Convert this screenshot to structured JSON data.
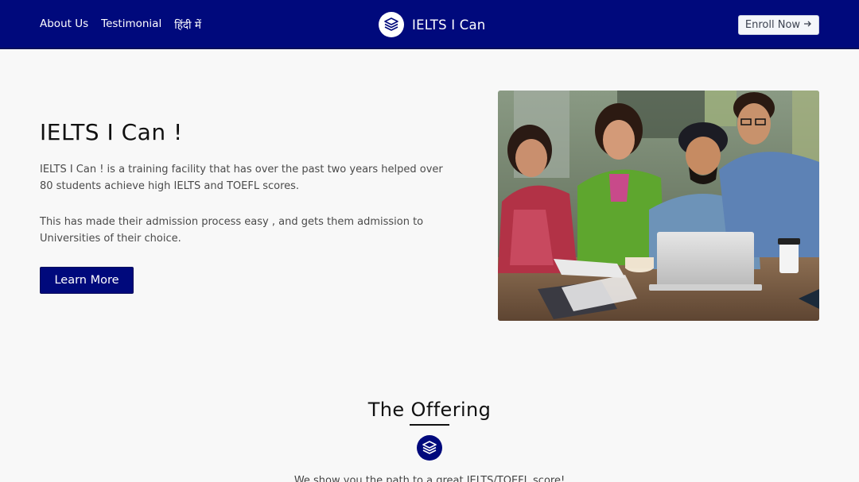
{
  "nav": {
    "links": [
      "About Us",
      "Testimonial",
      "हिंदी में"
    ],
    "brand": "IELTS I Can",
    "brand_icon": "layers-icon",
    "enroll_label": "Enroll Now",
    "enroll_icon": "arrow-right-icon"
  },
  "hero": {
    "title": "IELTS I Can !",
    "paragraph1": "IELTS I Can ! is a training facility that has over the past two years helped over 80 students achieve high IELTS and TOEFL scores.",
    "paragraph2": "This has made their admission process easy , and gets them admission to Universities of their choice.",
    "button": "Learn More"
  },
  "offering": {
    "title": "The Offering",
    "icon": "layers-icon",
    "subtitle": "We show you the path to a great IELTS/TOEFL score!"
  },
  "colors": {
    "primary": "#00097c",
    "background": "#f8f8f8"
  }
}
